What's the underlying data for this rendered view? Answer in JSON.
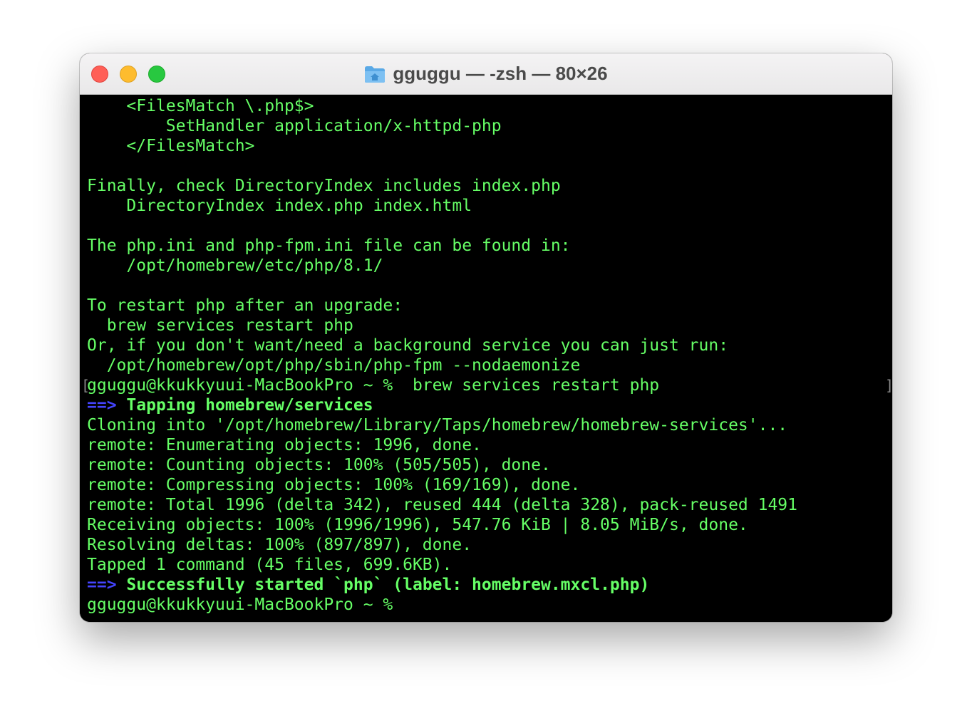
{
  "window": {
    "title": "gguggu — -zsh — 80×26",
    "folder_icon": "home-folder-icon",
    "colors": {
      "close": "#ff5f57",
      "minimize": "#febc2e",
      "zoom": "#28c840",
      "background": "#000000",
      "text": "#66ff66",
      "arrow": "#4444ff"
    }
  },
  "terminal": {
    "lines": [
      "    <FilesMatch \\.php$>",
      "        SetHandler application/x-httpd-php",
      "    </FilesMatch>",
      "",
      "Finally, check DirectoryIndex includes index.php",
      "    DirectoryIndex index.php index.html",
      "",
      "The php.ini and php-fpm.ini file can be found in:",
      "    /opt/homebrew/etc/php/8.1/",
      "",
      "To restart php after an upgrade:",
      "  brew services restart php",
      "Or, if you don't want/need a background service you can just run:",
      "  /opt/homebrew/opt/php/sbin/php-fpm --nodaemonize"
    ],
    "prompt_command": "gguggu@kkukkyuui-MacBookPro ~ %  brew services restart php",
    "mark_left": "[",
    "mark_right": "]",
    "tap_arrow": "==>",
    "tap_header": "Tapping homebrew/services",
    "output": [
      "Cloning into '/opt/homebrew/Library/Taps/homebrew/homebrew-services'...",
      "remote: Enumerating objects: 1996, done.",
      "remote: Counting objects: 100% (505/505), done.",
      "remote: Compressing objects: 100% (169/169), done.",
      "remote: Total 1996 (delta 342), reused 444 (delta 328), pack-reused 1491",
      "Receiving objects: 100% (1996/1996), 547.76 KiB | 8.05 MiB/s, done.",
      "Resolving deltas: 100% (897/897), done.",
      "Tapped 1 command (45 files, 699.6KB)."
    ],
    "success_arrow": "==>",
    "success_message": "Successfully started `php` (label: homebrew.mxcl.php)",
    "final_prompt": "gguggu@kkukkyuui-MacBookPro ~ %"
  }
}
